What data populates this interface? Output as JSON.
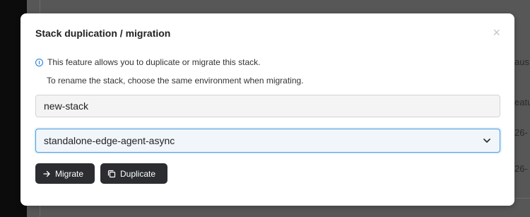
{
  "modal": {
    "title": "Stack duplication / migration",
    "close_symbol": "×",
    "info_text": "This feature allows you to duplicate or migrate this stack.",
    "sub_text": "To rename the stack, choose the same environment when migrating.",
    "name_input_value": "new-stack",
    "environment_selected": "standalone-edge-agent-async",
    "migrate_label": "Migrate",
    "duplicate_label": "Duplicate"
  },
  "background": {
    "fragments": [
      "eatu",
      "aus",
      "26-",
      "26-"
    ]
  },
  "icons": {
    "info": "info-circle-icon",
    "close": "close-icon",
    "select": "chevron-down-icon",
    "migrate": "arrow-right-icon",
    "duplicate": "copy-icon"
  },
  "colors": {
    "accent": "#1f7ad6",
    "button_bg": "#2b2d31",
    "select_border": "#4a9de0"
  }
}
